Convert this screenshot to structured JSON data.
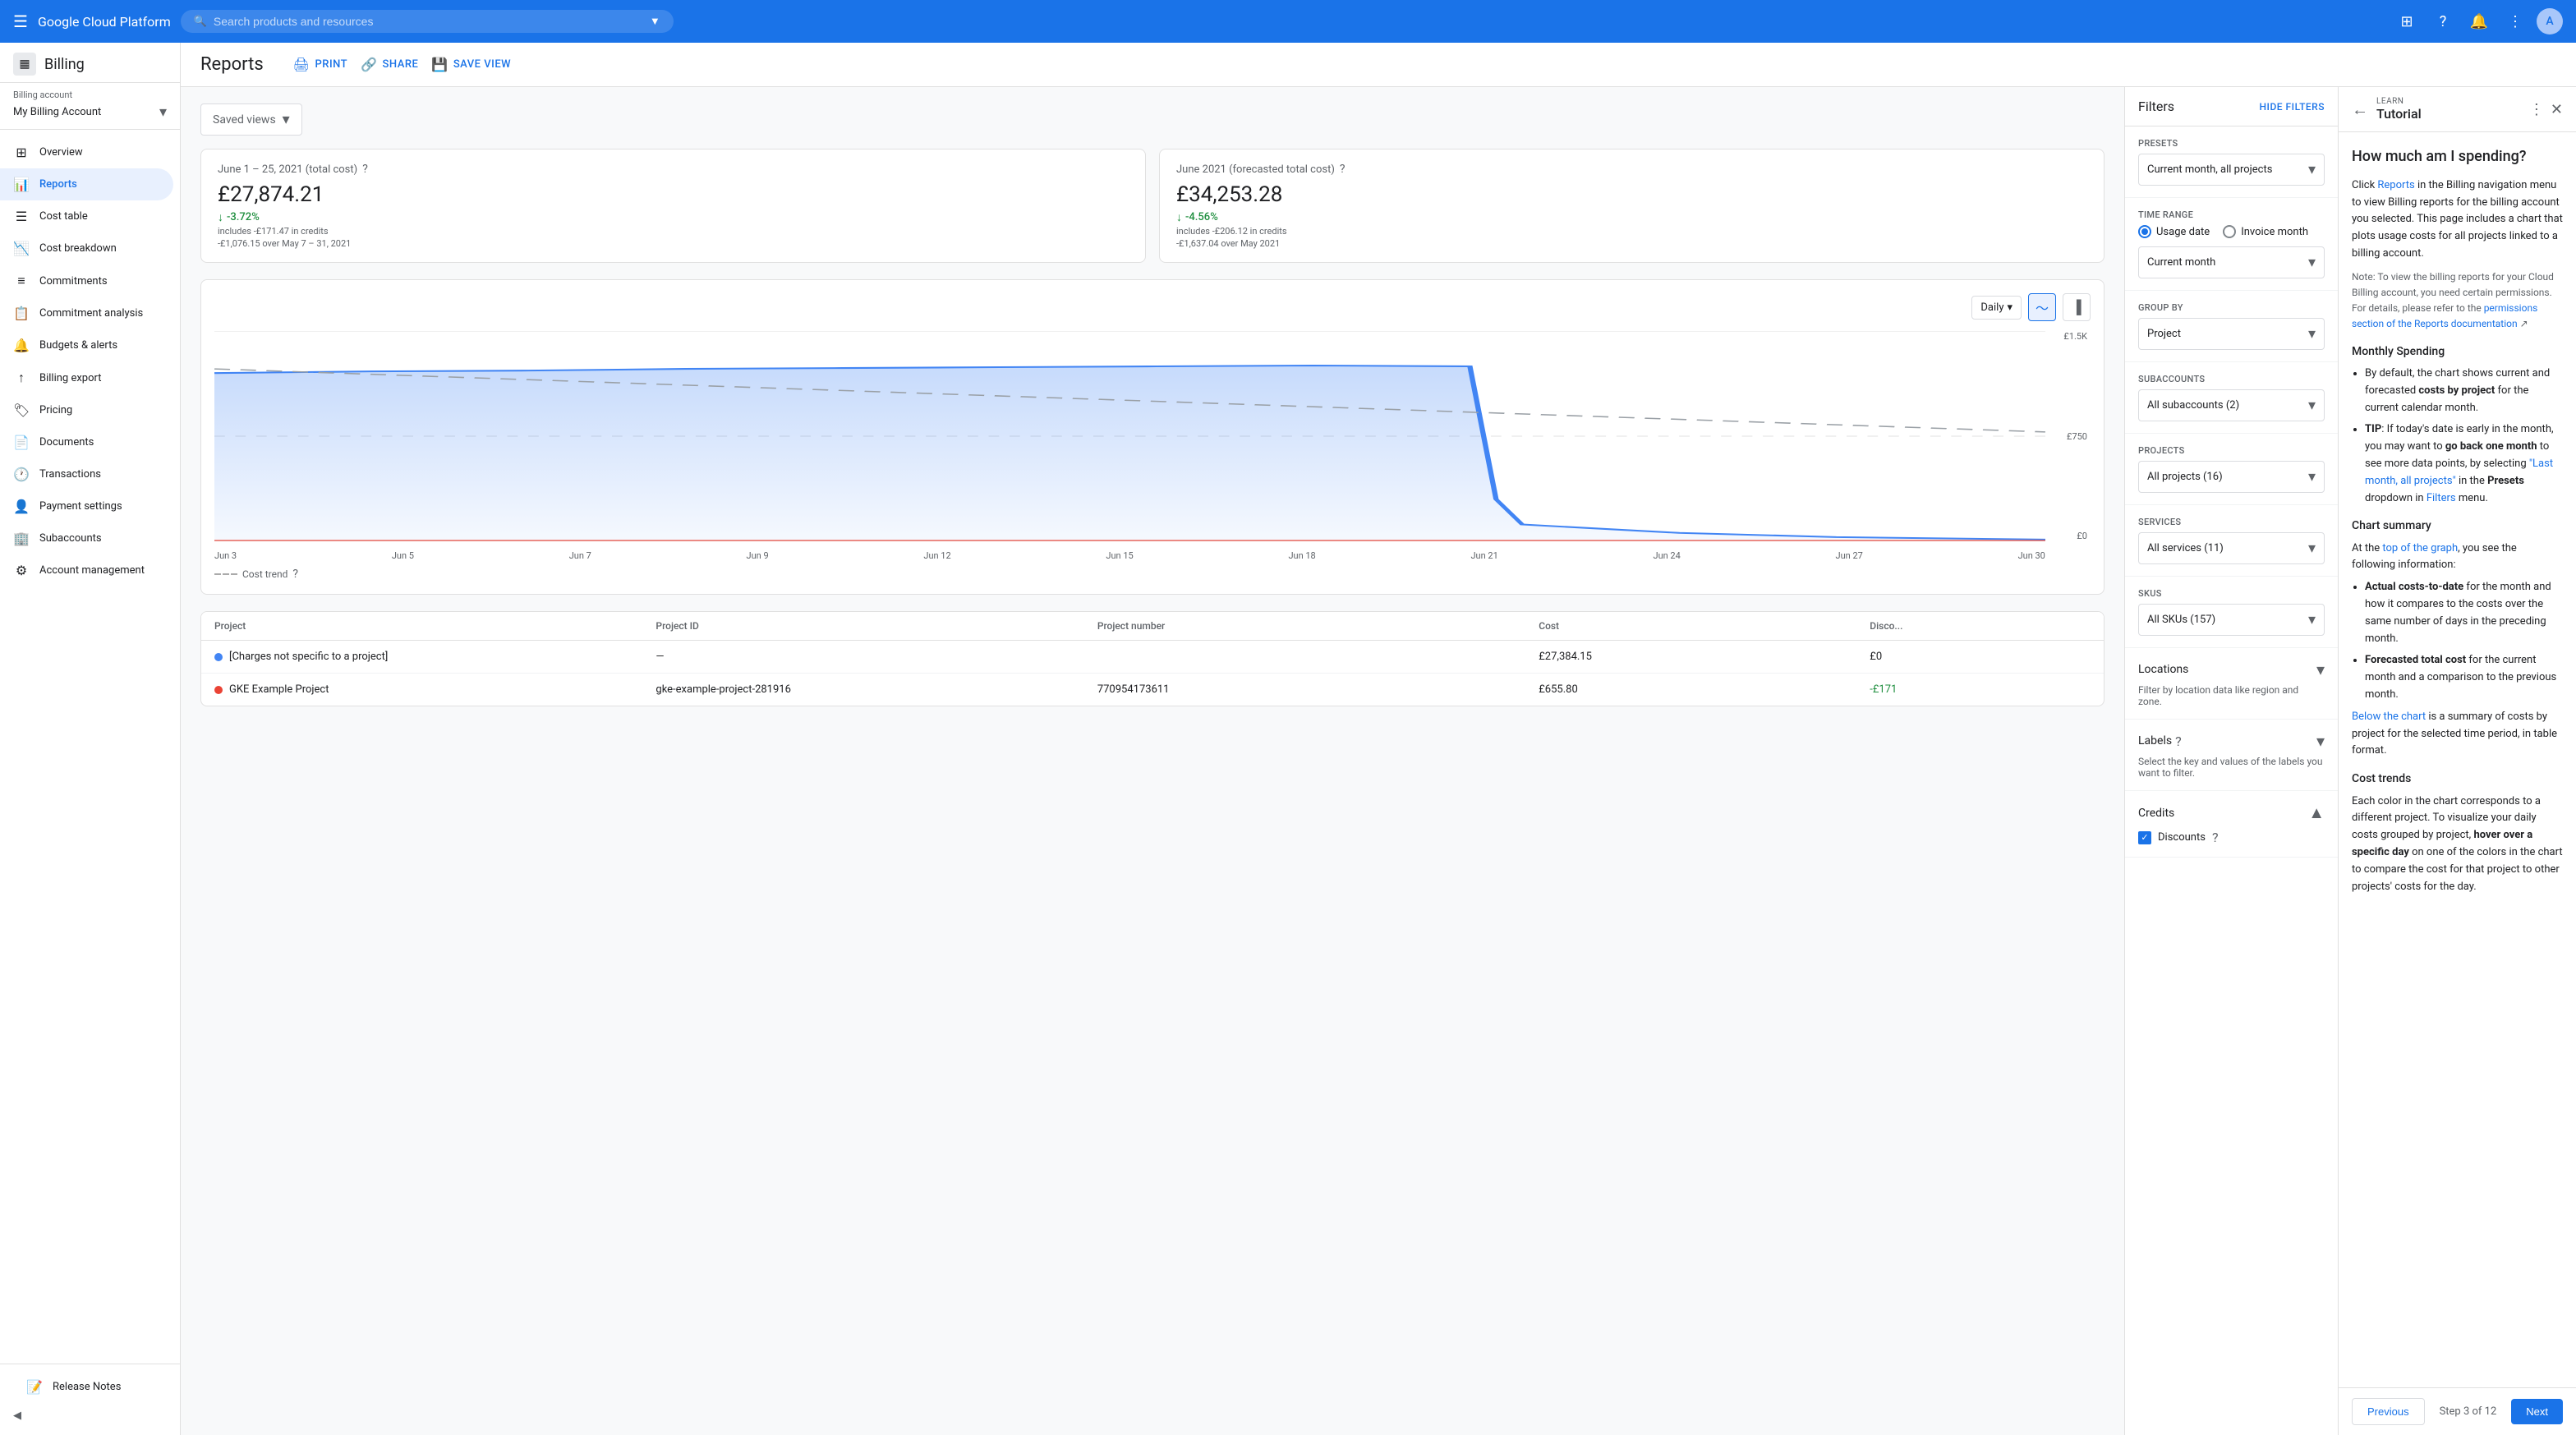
{
  "topnav": {
    "app_name": "Google Cloud Platform",
    "search_placeholder": "Search products and resources"
  },
  "sidebar": {
    "billing_icon": "▦",
    "billing_title": "Billing",
    "account_label": "Billing account",
    "account_name": "My Billing Account",
    "nav_items": [
      {
        "id": "overview",
        "icon": "⊞",
        "label": "Overview"
      },
      {
        "id": "reports",
        "icon": "📊",
        "label": "Reports",
        "active": true
      },
      {
        "id": "cost-table",
        "icon": "☰",
        "label": "Cost table"
      },
      {
        "id": "cost-breakdown",
        "icon": "📉",
        "label": "Cost breakdown"
      },
      {
        "id": "commitments",
        "icon": "≡",
        "label": "Commitments"
      },
      {
        "id": "commitment-analysis",
        "icon": "📋",
        "label": "Commitment analysis"
      },
      {
        "id": "budgets-alerts",
        "icon": "🔔",
        "label": "Budgets & alerts"
      },
      {
        "id": "billing-export",
        "icon": "↑",
        "label": "Billing export"
      },
      {
        "id": "pricing",
        "icon": "🏷",
        "label": "Pricing"
      },
      {
        "id": "documents",
        "icon": "📄",
        "label": "Documents"
      },
      {
        "id": "transactions",
        "icon": "🕐",
        "label": "Transactions"
      },
      {
        "id": "payment-settings",
        "icon": "👤",
        "label": "Payment settings"
      },
      {
        "id": "subaccounts",
        "icon": "🏢",
        "label": "Subaccounts"
      },
      {
        "id": "account-management",
        "icon": "⚙",
        "label": "Account management"
      }
    ],
    "release_notes": "Release Notes",
    "collapse_label": "◀"
  },
  "reports": {
    "title": "Reports",
    "actions": {
      "print": "PRINT",
      "share": "SHARE",
      "save_view": "SAVE VIEW"
    },
    "saved_views": "Saved views",
    "summary": {
      "actual": {
        "title": "June 1 – 25, 2021 (total cost)",
        "amount": "£27,874.21",
        "change": "-3.72%",
        "sub1": "includes -£171.47 in credits",
        "sub2": "-£1,076.15 over May 7 – 31, 2021"
      },
      "forecast": {
        "title": "June 2021 (forecasted total cost)",
        "amount": "£34,253.28",
        "change": "-4.56%",
        "sub1": "includes -£206.12 in credits",
        "sub2": "-£1,637.04 over May 2021"
      }
    },
    "chart": {
      "period_label": "Daily",
      "y_labels": [
        "£1.5K",
        "£750",
        "£0"
      ],
      "x_labels": [
        "Jun 3",
        "Jun 5",
        "Jun 7",
        "Jun 9",
        "Jun 12",
        "Jun 15",
        "Jun 18",
        "Jun 21",
        "Jun 24",
        "Jun 27",
        "Jun 30"
      ],
      "cost_trend_label": "Cost trend"
    },
    "table": {
      "columns": [
        "Project",
        "Project ID",
        "Project number",
        "Cost",
        "Disco..."
      ],
      "rows": [
        {
          "color": "#4285f4",
          "project": "[Charges not specific to a project]",
          "project_id": "—",
          "project_number": "",
          "cost": "£27,384.15",
          "discount": "£0"
        },
        {
          "color": "#ea4335",
          "project": "GKE Example Project",
          "project_id": "gke-example-project-281916",
          "project_number": "770954173611",
          "cost": "£655.80",
          "discount": "-£171"
        }
      ]
    }
  },
  "filters": {
    "title": "Filters",
    "hide_label": "HIDE FILTERS",
    "presets": {
      "label": "Presets",
      "value": "Current month, all projects"
    },
    "time_range": {
      "label": "Time range",
      "options": [
        "Usage date",
        "Invoice month"
      ],
      "selected": "Usage date",
      "period_label": "Current month"
    },
    "group_by": {
      "label": "Group by",
      "value": "Project"
    },
    "subaccounts": {
      "label": "Subaccounts",
      "value": "All subaccounts (2)"
    },
    "projects": {
      "label": "Projects",
      "value": "All projects (16)"
    },
    "services": {
      "label": "Services",
      "value": "All services (11)"
    },
    "skus": {
      "label": "SKUs",
      "value": "All SKUs (157)"
    },
    "locations": {
      "label": "Locations",
      "desc": "Filter by location data like region and zone."
    },
    "labels": {
      "label": "Labels",
      "desc": "Select the key and values of the labels you want to filter."
    },
    "credits": {
      "label": "Credits",
      "discounts": "Discounts"
    }
  },
  "tutorial": {
    "learn_label": "LEARN",
    "title": "Tutorial",
    "main_title": "How much am I spending?",
    "intro": "Click Reports in the Billing navigation menu to view Billing reports for the billing account you selected. This page includes a chart that plots usage costs for all projects linked to a billing account.",
    "note": "Note: To view the billing reports for your Cloud Billing account, you need certain permissions. For details, please refer to the permissions section of the Reports documentation",
    "monthly_spending_title": "Monthly Spending",
    "monthly_items": [
      "By default, the chart shows current and forecasted costs by project for the current calendar month.",
      "TIP: If today's date is early in the month, you may want to go back one month to see more data points, by selecting \"Last month, all projects\" in the Presets dropdown in Filters menu."
    ],
    "chart_summary_title": "Chart summary",
    "chart_summary_intro": "At the top of the graph, you see the following information:",
    "chart_summary_items": [
      "Actual costs-to-date for the month and how it compares to the costs over the same number of days in the preceding month.",
      "Forecasted total cost for the current month and a comparison to the previous month."
    ],
    "below_chart": "Below the chart is a summary of costs by project for the selected time period, in table format.",
    "cost_trends_title": "Cost trends",
    "cost_trends_text": "Each color in the chart corresponds to a different project. To visualize your daily costs grouped by project, hover over a specific day on one of the colors in the chart to compare the cost for that project to other projects' costs for the day.",
    "footer": {
      "prev_label": "Previous",
      "step_label": "Step 3 of 12",
      "next_label": "Next"
    }
  }
}
